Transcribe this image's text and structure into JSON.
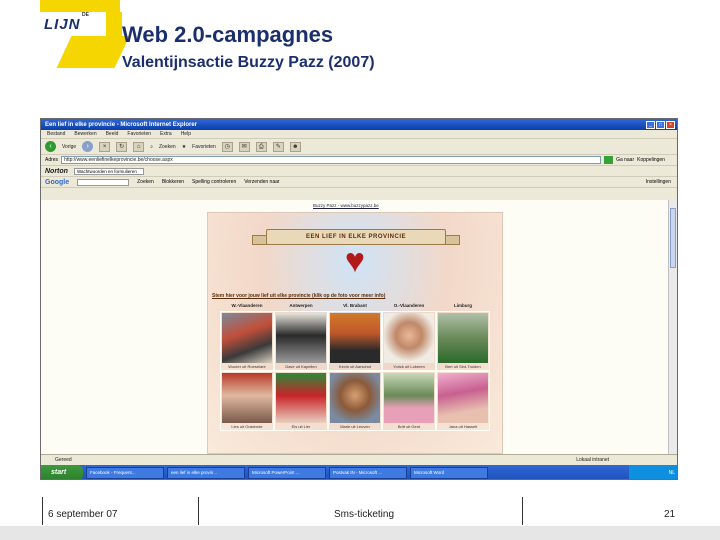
{
  "slide": {
    "title": "Web 2.0-campagnes",
    "subtitle": "Valentijnsactie Buzzy Pazz (2007)",
    "logo_text": "LIJN",
    "logo_small_text": "DE"
  },
  "browser": {
    "window_title": "Een lief in elke provincie - Microsoft Internet Explorer",
    "menu": [
      "Bestand",
      "Bewerken",
      "Beeld",
      "Favorieten",
      "Extra",
      "Help"
    ],
    "toolbar": {
      "back": "Vorige",
      "search": "Zoeken",
      "favorites": "Favorieten"
    },
    "address_label": "Adres",
    "address_value": "http://www.eenliefinelkeprovincie.be/choose.aspx",
    "go_label": "Ga naar",
    "links_label": "Koppelingen",
    "norton": {
      "logo": "Norton",
      "field": "Wachtwoorden en formulieren"
    },
    "google": {
      "logo": "Google",
      "items": [
        "Zoeken",
        "Blokkeren",
        "Spelling controleren",
        "Verzenden naar"
      ],
      "settings": "Instellingen"
    },
    "page_link": "Buzzy Pazz - www.buzzypazz.be",
    "campaign": {
      "banner": "EEN LIEF IN ELKE PROVINCIE",
      "instruction": "Stem hier voor jouw lief uit elke provincie (klik op de foto voor meer info)",
      "provinces": [
        "W.-Vlaanderen",
        "Antwerpen",
        "Vl. Brabant",
        "O.-Vlaanderen",
        "Limburg"
      ],
      "captions": [
        "Wouter uit Roeselare",
        "Dave uit Kapellen",
        "Kevin uit Aarschot",
        "Yorick uit Lokeren",
        "Bert uit Sint-Truiden",
        "Lies uit Oostende",
        "Els uit Lier",
        "Marie uit Leuven",
        "Britt uit Gent",
        "Jana uit Hasselt"
      ]
    },
    "status_text": "Gereed",
    "status_zone": "Lokaal intranet",
    "taskbar": {
      "start": "start",
      "tasks": [
        "Facebook - Frequent...",
        "een lief in elke provin...",
        "Microsoft PowerPoint ...",
        "Postvak IN - Microsoft ...",
        "Microsoft Word"
      ],
      "tray": "NL"
    }
  },
  "footer": {
    "date": "6 september 07",
    "center": "Sms-ticketing",
    "page_number": "21"
  }
}
